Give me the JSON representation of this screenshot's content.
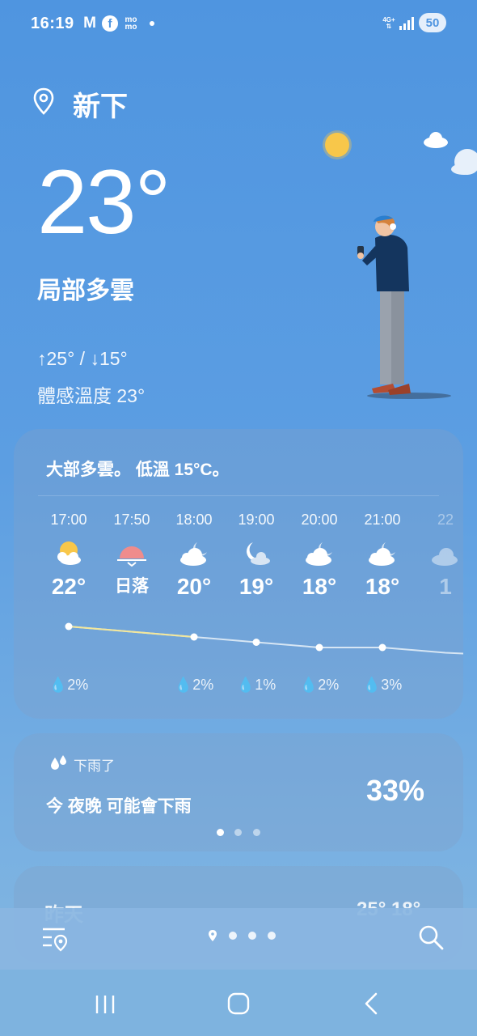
{
  "status_bar": {
    "time": "16:19",
    "icons": [
      "gmail-icon",
      "facebook-icon",
      "momo-icon",
      "dot-icon",
      "network-4g-icon",
      "signal-icon"
    ],
    "gmail_glyph": "M",
    "facebook_glyph": "f",
    "momo_line1": "mo",
    "momo_line2": "mo",
    "network_line1": "4G+",
    "network_line2": "⇅",
    "battery": "50"
  },
  "location": {
    "name": "新下"
  },
  "current": {
    "temp": "23°",
    "condition": "局部多雲",
    "hi_lo": "↑25° / ↓15°",
    "feels_like": "體感溫度 23°"
  },
  "hourly": {
    "summary": "大部多雲。 低溫 15°C。",
    "items": [
      {
        "time": "17:00",
        "icon": "sun-cloud-icon",
        "temp": "22°",
        "precip": "2%",
        "temp_value": 22
      },
      {
        "time": "17:50",
        "icon": "sunset-icon",
        "temp": "日落",
        "precip": "",
        "temp_value": null
      },
      {
        "time": "18:00",
        "icon": "cloudy-night-icon",
        "temp": "20°",
        "precip": "2%",
        "temp_value": 20
      },
      {
        "time": "19:00",
        "icon": "moon-cloud-icon",
        "temp": "19°",
        "precip": "1%",
        "temp_value": 19
      },
      {
        "time": "20:00",
        "icon": "cloudy-night-icon",
        "temp": "18°",
        "precip": "2%",
        "temp_value": 18
      },
      {
        "time": "21:00",
        "icon": "cloudy-night-icon",
        "temp": "18°",
        "precip": "3%",
        "temp_value": 18
      },
      {
        "time": "22",
        "icon": "cloudy-night-icon",
        "temp": "1",
        "precip": "",
        "temp_value": 17
      }
    ]
  },
  "rain": {
    "header": "下雨了",
    "message": "今 夜晚 可能會下雨",
    "percent": "33%",
    "pages": 3,
    "active_page": 0
  },
  "yesterday": {
    "label": "昨天",
    "range": "25° 18°"
  },
  "toolbar": {
    "locations_button": "location-list-icon",
    "search_button": "search-icon",
    "location_pages": 4
  },
  "nav": {
    "recent": "recent-apps-icon",
    "home": "home-icon",
    "back": "back-icon"
  },
  "colors": {
    "background_top": "#4f95e0",
    "background_bottom": "#86b8df",
    "sun": "#f8c74a",
    "sunset": "#ef8c8c",
    "graph_line_warm": "#f3e79a",
    "graph_line_cool": "#d7e6f4"
  }
}
